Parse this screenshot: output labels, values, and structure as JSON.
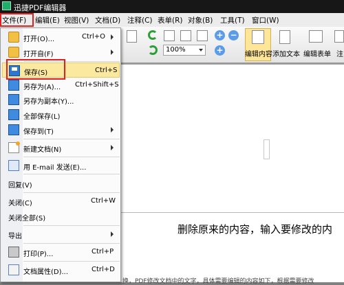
{
  "window": {
    "title": "迅捷PDF编辑器"
  },
  "menubar": {
    "items": [
      {
        "label": "文件(F)"
      },
      {
        "label": "编辑(E)"
      },
      {
        "label": "视图(V)"
      },
      {
        "label": "文档(D)"
      },
      {
        "label": "注释(C)"
      },
      {
        "label": "表单(R)"
      },
      {
        "label": "对象(B)"
      },
      {
        "label": "工具(T)"
      },
      {
        "label": "窗口(W)"
      }
    ]
  },
  "toolbar": {
    "zoom_value": "100%",
    "edit_content_label": "编辑内容",
    "add_text_label": "添加文本",
    "edit_form_label": "编辑表单",
    "annot_label": "注"
  },
  "file_menu": {
    "items": [
      {
        "label": "打开(O)...",
        "shortcut": "Ctrl+O",
        "icon": "open-folder-icon",
        "submenu": true
      },
      {
        "label": "打开自(F)",
        "shortcut": "",
        "icon": "open-from-icon",
        "submenu": true
      },
      {
        "label": "保存(S)",
        "shortcut": "Ctrl+S",
        "icon": "save-icon",
        "submenu": false
      },
      {
        "label": "另存为(A)...",
        "shortcut": "Ctrl+Shift+S",
        "icon": "save-as-icon",
        "submenu": false
      },
      {
        "label": "另存为副本(Y)...",
        "shortcut": "",
        "icon": "save-copy-icon",
        "submenu": false
      },
      {
        "label": "全部保存(L)",
        "shortcut": "",
        "icon": "save-all-icon",
        "submenu": false
      },
      {
        "label": "保存到(T)",
        "shortcut": "",
        "icon": "save-to-icon",
        "submenu": true
      },
      {
        "label": "新建文档(N)",
        "shortcut": "",
        "icon": "new-document-icon",
        "submenu": true
      },
      {
        "label": "用 E-mail 发送(E)...",
        "shortcut": "",
        "icon": "email-icon",
        "submenu": false
      },
      {
        "label": "回复(V)",
        "shortcut": "",
        "icon": "",
        "submenu": false
      },
      {
        "label": "关闭(C)",
        "shortcut": "Ctrl+W",
        "icon": "",
        "submenu": false
      },
      {
        "label": "关闭全部(S)",
        "shortcut": "",
        "icon": "",
        "submenu": false
      },
      {
        "label": "导出",
        "shortcut": "",
        "icon": "",
        "submenu": true
      },
      {
        "label": "打印(P)...",
        "shortcut": "Ctrl+P",
        "icon": "print-icon",
        "submenu": false
      },
      {
        "label": "文档属性(D)...",
        "shortcut": "Ctrl+D",
        "icon": "properties-icon",
        "submenu": false
      }
    ]
  },
  "document": {
    "text_line": "删除原来的内容，输入要修改的内",
    "bottom_text": "换，PDF修改文档中的文字，具体需要编辑的内容如下，根据需要修改"
  },
  "colors": {
    "highlight": "#fce9a0",
    "annotation_red": "#e0201e",
    "titlebar": "#171717"
  }
}
